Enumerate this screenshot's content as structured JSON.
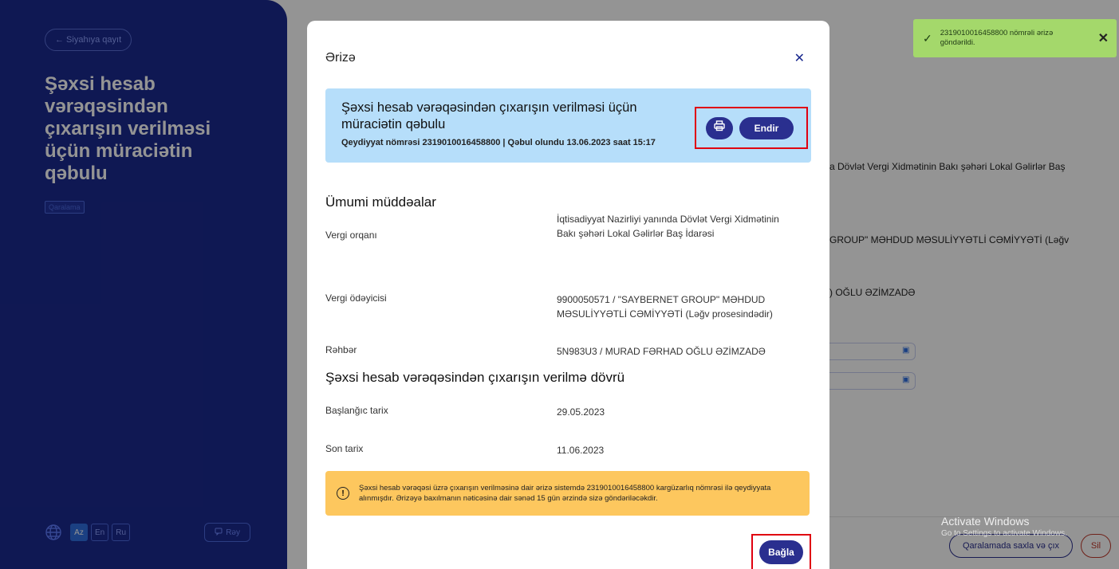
{
  "sidebar": {
    "back_label": "← Siyahıya qayıt",
    "title": "Şəxsi hesab vərəqəsindən çıxarışın verilməsi üçün müraciətin qəbulu",
    "status_badge": "Qaralama",
    "languages": [
      "Az",
      "En",
      "Ru"
    ],
    "active_language": "Az",
    "feedback_label": "Rəy"
  },
  "background": {
    "line1": "a Dövlət Vergi Xidmətinin Bakı şəhəri Lokal Gəlirlər Baş",
    "line2": "GROUP\" MƏHDUD MƏSULİYYƏTLİ CƏMİYYƏTİ (Ləğv",
    "line3": ") OĞLU ƏZİMZADƏ",
    "save_draft_label": "Qaralamada saxla və çıx",
    "delete_label": "Sil",
    "watermark_title": "Activate Windows",
    "watermark_sub": "Go to Settings to activate Windows."
  },
  "toast": {
    "message": "2319010016458800 nömrəli ərizə göndərildi."
  },
  "modal": {
    "title": "Ərizə",
    "card": {
      "title": "Şəxsi hesab vərəqəsindən çıxarışın verilməsi üçün müraciətin qəbulu",
      "subtitle": "Qeydiyyat nömrəsi 2319010016458800 | Qəbul olundu 13.06.2023 saat 15:17",
      "download_label": "Endir"
    },
    "general": {
      "heading": "Ümumi müddəalar",
      "rows": [
        {
          "label": "Vergi orqanı",
          "value": "İqtisadiyyat Nazirliyi yanında Dövlət Vergi Xidmətinin Bakı şəhəri Lokal Gəlirlər Baş İdarəsi"
        },
        {
          "label": "Vergi ödəyicisi",
          "value": "9900050571 / \"SAYBERNET GROUP\" MƏHDUD MƏSULİYYƏTLİ CƏMİYYƏTİ (Ləğv prosesindədir)"
        },
        {
          "label": "Rəhbər",
          "value": "5N983U3 / MURAD FƏRHAD OĞLU ƏZİMZADƏ"
        }
      ]
    },
    "period": {
      "heading": "Şəxsi hesab vərəqəsindən çıxarışın verilmə dövrü",
      "rows": [
        {
          "label": "Başlanğıc tarix",
          "value": "29.05.2023"
        },
        {
          "label": "Son tarix",
          "value": "11.06.2023"
        }
      ]
    },
    "notice": "Şəxsi hesab vərəqəsi üzrə çıxarışın verilməsinə dair ərizə sistemdə 2319010016458800 kargüzarlıq nömrəsi ilə qeydiyyata alınmışdır. Ərizəyə baxılmanın nəticəsinə dair sənəd 15 gün ərzində sizə göndəriləcəkdir.",
    "close_label": "Bağla"
  },
  "colors": {
    "brand": "#2a2f8f",
    "sidebar": "#1b2a8f",
    "card": "#b6defa",
    "notice": "#fdc75e",
    "toast": "#a4d86b",
    "highlight": "#e00010"
  }
}
